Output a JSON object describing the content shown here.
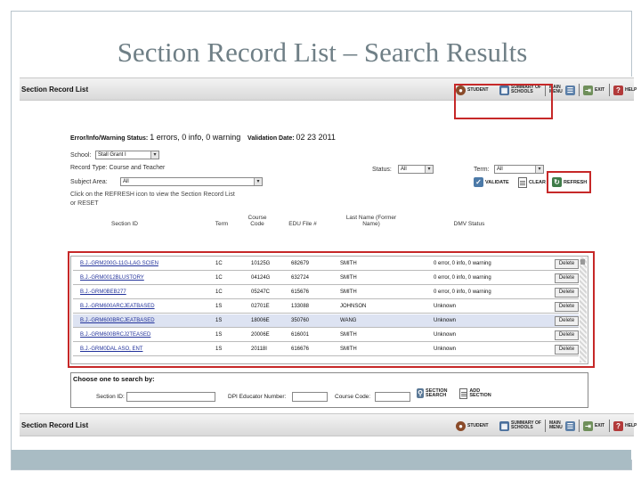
{
  "slide": {
    "title": "Section Record List – Search Results"
  },
  "header": {
    "title": "Section Record List",
    "nav": [
      {
        "label": "Student",
        "icon": "student-icon"
      },
      {
        "label": "Summary of Schools",
        "icon": "summary-icon"
      },
      {
        "label": "Main Menu",
        "icon": "main-menu-icon"
      },
      {
        "label": "Exit",
        "icon": "exit-icon"
      },
      {
        "label": "Help",
        "icon": "help-icon"
      }
    ]
  },
  "status": {
    "label": "Error/Info/Warning Status:",
    "value": "1 errors, 0 info, 0 warning",
    "date_label": "Validation Date:",
    "date_value": "02 23 2011"
  },
  "filters": {
    "school_label": "School:",
    "school_value": "Stall Grant I",
    "record_type_label": "Record Type: Course and Teacher",
    "status_label": "Status:",
    "status_value": "All",
    "term_label": "Term:",
    "term_value": "All",
    "subject_label": "Subject Area:",
    "subject_value": "All"
  },
  "actions": {
    "validate": "Validate",
    "clear": "Clear",
    "refresh": "Refresh"
  },
  "hint": {
    "line1": "Click on the REFRESH icon to view the Section Record List",
    "line2": "or RESET"
  },
  "table": {
    "headers": [
      "Section ID",
      "Term",
      "Course Code",
      "EDU File #",
      "Last Name (Former Name)",
      "DMV Status"
    ],
    "delete_label": "Delete",
    "rows": [
      {
        "section_id": "B.J.-GRM200G-11G-LAG SCIEN",
        "term": "1C",
        "course": "10125G",
        "edu": "682679",
        "last": "SMITH",
        "status": "0 error, 0 info, 0 warning"
      },
      {
        "section_id": "B.J.-GRM0012BLUSTORY",
        "term": "1C",
        "course": "04124G",
        "edu": "632724",
        "last": "SMITH",
        "status": "0 error, 0 info, 0 warning"
      },
      {
        "section_id": "B.J.-GRM0BEB277",
        "term": "1C",
        "course": "05247C",
        "edu": "615676",
        "last": "SMITH",
        "status": "0 error, 0 info, 0 warning"
      },
      {
        "section_id": "B.J.-GRM600ARCJEATBASED",
        "term": "1S",
        "course": "02701E",
        "edu": "133088",
        "last": "JOHNSON",
        "status": "Unknown"
      },
      {
        "section_id": "B.J.-GRM600BRCJEATBASED",
        "term": "1S",
        "course": "18006E",
        "edu": "350760",
        "last": "WANG",
        "status": "Unknown"
      },
      {
        "section_id": "B.J.-GRM600BRCJ2TEASED",
        "term": "1S",
        "course": "20006E",
        "edu": "616001",
        "last": "SMITH",
        "status": "Unknown"
      },
      {
        "section_id": "B.J.-GRM0DAL ASO, ENT",
        "term": "1S",
        "course": "20118I",
        "edu": "616676",
        "last": "SMITH",
        "status": "Unknown"
      }
    ]
  },
  "search": {
    "title": "Choose one to search by:",
    "section_id_label": "Section ID:",
    "dpi_label": "DPI Educator Number:",
    "course_label": "Course Code:",
    "section_search": "Section Search",
    "add_section": "Add Section"
  },
  "footer_bar": {
    "title": "Section Record List"
  },
  "colors": {
    "highlight": "#c62828",
    "slide_title": "#6f7f86",
    "footer": "#a9bcc4",
    "link": "#22329b"
  }
}
